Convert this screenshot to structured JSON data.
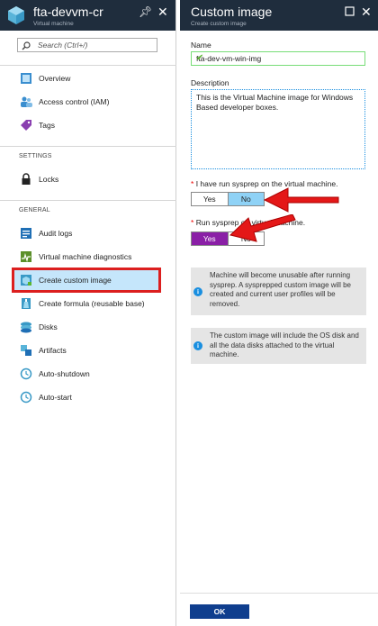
{
  "left_blade": {
    "title": "fta-devvm-cr",
    "subtitle": "Virtual machine",
    "search_placeholder": "Search (Ctrl+/)",
    "items_top": [
      {
        "label": "Overview",
        "icon": "overview-icon"
      },
      {
        "label": "Access control (IAM)",
        "icon": "iam-icon"
      },
      {
        "label": "Tags",
        "icon": "tag-icon"
      }
    ],
    "settings_heading": "SETTINGS",
    "settings_items": [
      {
        "label": "Locks",
        "icon": "lock-icon"
      }
    ],
    "general_heading": "GENERAL",
    "general_items": [
      {
        "label": "Audit logs",
        "icon": "audit-logs-icon"
      },
      {
        "label": "Virtual machine diagnostics",
        "icon": "diagnostics-icon"
      },
      {
        "label": "Create custom image",
        "icon": "custom-image-icon",
        "selected": true
      },
      {
        "label": "Create formula (reusable base)",
        "icon": "formula-icon"
      },
      {
        "label": "Disks",
        "icon": "disks-icon"
      },
      {
        "label": "Artifacts",
        "icon": "artifacts-icon"
      },
      {
        "label": "Auto-shutdown",
        "icon": "clock-icon"
      },
      {
        "label": "Auto-start",
        "icon": "clock-icon"
      }
    ]
  },
  "right_blade": {
    "title": "Custom image",
    "subtitle": "Create custom image",
    "name_label": "Name",
    "name_value": "fta-dev-vm-win-img",
    "description_label": "Description",
    "description_value": "This is the Virtual Machine image for Windows Based developer boxes.",
    "sysprep_done_label": "I have run sysprep on the virtual machine.",
    "sysprep_done_yes": "Yes",
    "sysprep_done_no": "No",
    "sysprep_done_selected": "No",
    "run_sysprep_label": "Run sysprep on virtual machine.",
    "run_sysprep_yes": "Yes",
    "run_sysprep_no": "No",
    "run_sysprep_selected": "Yes",
    "info1": "Machine will become unusable after running sysprep. A sysprepped custom image will be created and current user profiles will be removed.",
    "info2": "The custom image will include the OS disk and all the data disks attached to the virtual machine.",
    "ok_label": "OK"
  },
  "colors": {
    "header_bg": "#1f2d3d",
    "selected_item_bg": "#c5e6fb",
    "highlight_red": "#dc1f1f",
    "toggle_no_selected": "#8fd2f6",
    "toggle_yes_selected": "#8a1fa6",
    "ok_button": "#0f3e8e"
  }
}
